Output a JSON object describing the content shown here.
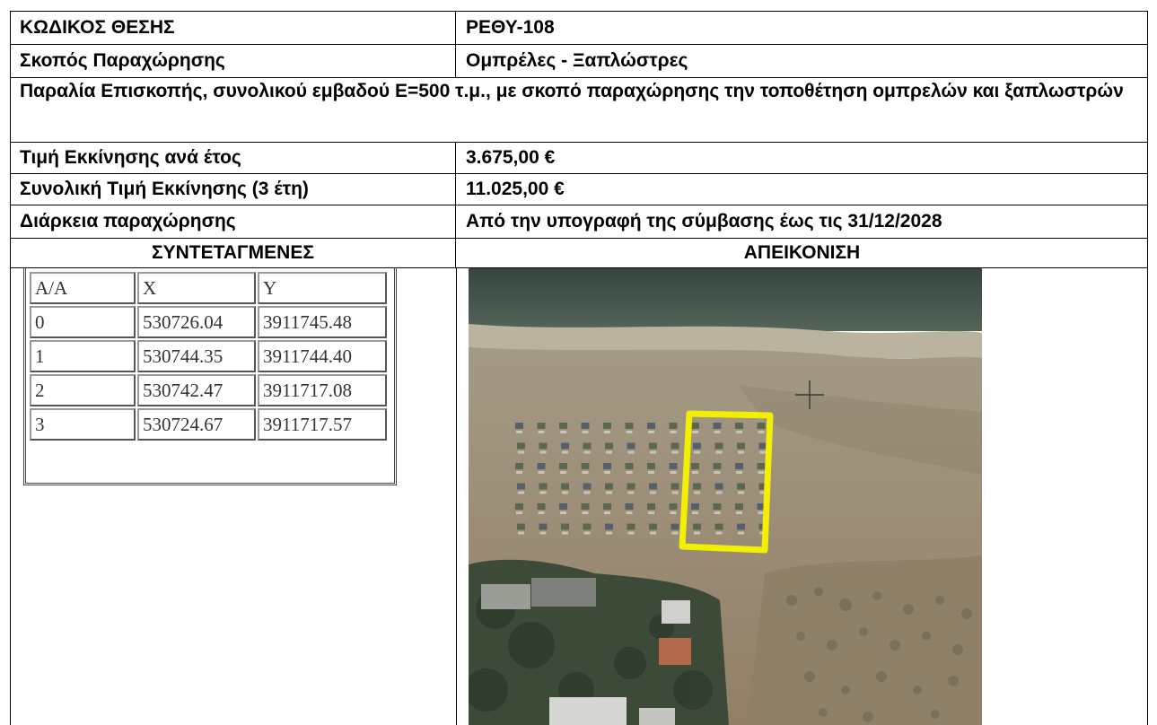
{
  "rows": {
    "code_label": "ΚΩΔΙΚΟΣ ΘΕΣΗΣ",
    "code_value": "ΡΕΘΥ-108",
    "purpose_label": "Σκοπός Παραχώρησης",
    "purpose_value": "Ομπρέλες - Ξαπλώστρες",
    "description": "Παραλία Επισκοπής, συνολικού εμβαδού Ε=500 τ.μ., με σκοπό παραχώρησης την τοποθέτηση ομπρελών και ξαπλωστρών",
    "annual_price_label": "Τιμή Εκκίνησης ανά έτος",
    "annual_price_value": "3.675,00 €",
    "total_price_label": "Συνολική Τιμή Εκκίνησης (3 έτη)",
    "total_price_value": "11.025,00 €",
    "duration_label": "Διάρκεια παραχώρησης",
    "duration_value": "Από την υπογραφή της σύμβασης έως τις 31/12/2028",
    "coords_header": "ΣΥΝΤΕΤΑΓΜΕΝΕΣ",
    "image_header": "ΑΠΕΙΚΟΝΙΣΗ"
  },
  "coordinates": {
    "headers": [
      "Α/Α",
      "X",
      "Y"
    ],
    "points": [
      [
        "0",
        "530726.04",
        "3911745.48"
      ],
      [
        "1",
        "530744.35",
        "3911744.40"
      ],
      [
        "2",
        "530742.47",
        "3911717.08"
      ],
      [
        "3",
        "530724.67",
        "3911717.57"
      ]
    ]
  },
  "colors": {
    "highlight": "#f2ef00",
    "sea": "#41524b",
    "sand": "#9a8a72"
  }
}
